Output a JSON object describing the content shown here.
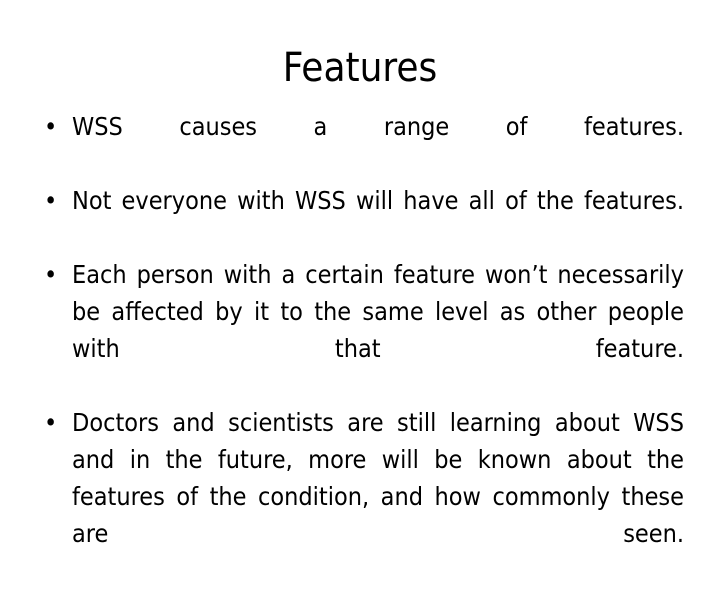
{
  "slide": {
    "title": "Features",
    "background_color": "#FFFFFF",
    "text_color": "#000000",
    "bullet_glyph": "•",
    "bullets": [
      {
        "text": "WSS causes a range of features."
      },
      {
        "text": "Not everyone with WSS will have all of the features."
      },
      {
        "text": "Each person with a certain feature won’t necessarily be affected by it to the same level as other people with that feature."
      },
      {
        "text": "Doctors and scientists are still learning about WSS and in the future, more will be known about the features of the condition, and how commonly these are seen."
      }
    ]
  }
}
